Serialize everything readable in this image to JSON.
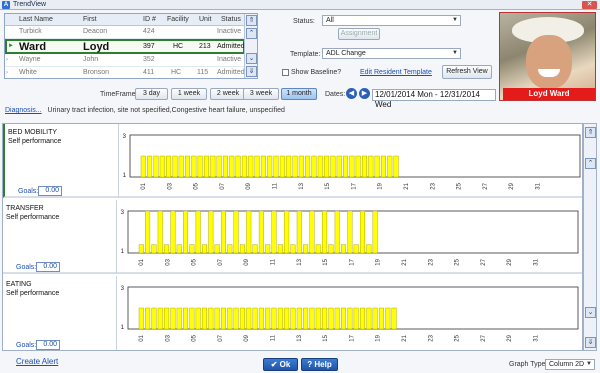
{
  "window": {
    "title": "TrendView",
    "app_icon": "A",
    "close": "✕"
  },
  "resident_table": {
    "headers": [
      "Last Name",
      "First",
      "ID #",
      "Facility",
      "Unit",
      "Status"
    ],
    "rows": [
      {
        "last": "Turbick",
        "first": "Deacon",
        "id": "424",
        "facility": "",
        "unit": "",
        "status": "Inactive",
        "selected": false
      },
      {
        "last": "Ward",
        "first": "Loyd",
        "id": "397",
        "facility": "HC",
        "unit": "213",
        "status": "Admitted",
        "selected": true
      },
      {
        "last": "Wayne",
        "first": "John",
        "id": "352",
        "facility": "",
        "unit": "",
        "status": "Inactive",
        "selected": false
      },
      {
        "last": "White",
        "first": "Bronson",
        "id": "411",
        "facility": "HC",
        "unit": "115",
        "status": "Admitted",
        "selected": false
      }
    ]
  },
  "controls": {
    "status_label": "Status:",
    "status_value": "All",
    "assignment_button": "Assignment",
    "template_label": "Template:",
    "template_value": "ADL Change",
    "show_baseline": "Show Baseline?",
    "edit_template": "Edit Resident Template",
    "refresh": "Refresh View",
    "timeframe_label": "TimeFrame:",
    "timeframes": [
      "3 day",
      "1 week",
      "2 week",
      "3 week",
      "1 month"
    ],
    "active_timeframe": "1 month",
    "dates_label": "Dates:",
    "date_range": "12/01/2014 Mon - 12/31/2014 Wed"
  },
  "resident": {
    "name": "Loyd Ward"
  },
  "diagnosis": {
    "label": "Diagnosis...",
    "text": "Urinary tract infection, site not specified,Congestive heart failure, unspecified"
  },
  "panels": [
    {
      "title": "BED MOBILITY",
      "subtitle": "Self performance",
      "goals_label": "Goals:",
      "goals_value": "0.00"
    },
    {
      "title": "TRANSFER",
      "subtitle": "Self performance",
      "goals_label": "Goals:",
      "goals_value": "0.00"
    },
    {
      "title": "EATING",
      "subtitle": "Self performance",
      "goals_label": "Goals:",
      "goals_value": "0.00"
    }
  ],
  "chart_data": [
    {
      "type": "bar",
      "title": "BED MOBILITY",
      "ylim": [
        1,
        3
      ],
      "yticks": [
        "3",
        "1"
      ],
      "xticks": [
        "01",
        "03",
        "05",
        "07",
        "09",
        "11",
        "13",
        "15",
        "17",
        "19",
        "21",
        "23",
        "25",
        "27",
        "29",
        "31"
      ],
      "bar_color": "#ffff00",
      "pattern": "uniform",
      "bar_count": 41,
      "bar_value": 2
    },
    {
      "type": "bar",
      "title": "TRANSFER",
      "ylim": [
        1,
        3
      ],
      "yticks": [
        "3",
        "1"
      ],
      "xticks": [
        "01",
        "03",
        "05",
        "07",
        "09",
        "11",
        "13",
        "15",
        "17",
        "19",
        "21",
        "23",
        "25",
        "27",
        "29",
        "31"
      ],
      "bar_color": "#ffff00",
      "pattern": "alternating",
      "bar_count": 38,
      "bar_value_high": 3,
      "bar_value_low": 1.4
    },
    {
      "type": "bar",
      "title": "EATING",
      "ylim": [
        1,
        3
      ],
      "yticks": [
        "3",
        "1"
      ],
      "xticks": [
        "01",
        "03",
        "05",
        "07",
        "09",
        "11",
        "13",
        "15",
        "17",
        "19",
        "21",
        "23",
        "25",
        "27",
        "29",
        "31"
      ],
      "bar_color": "#ffff00",
      "pattern": "uniform",
      "bar_count": 41,
      "bar_value": 2
    }
  ],
  "footer": {
    "create_alert": "Create Alert",
    "ok": "✔ Ok",
    "help": "? Help",
    "graph_type_label": "Graph Type",
    "graph_type_value": "Column 2D"
  }
}
